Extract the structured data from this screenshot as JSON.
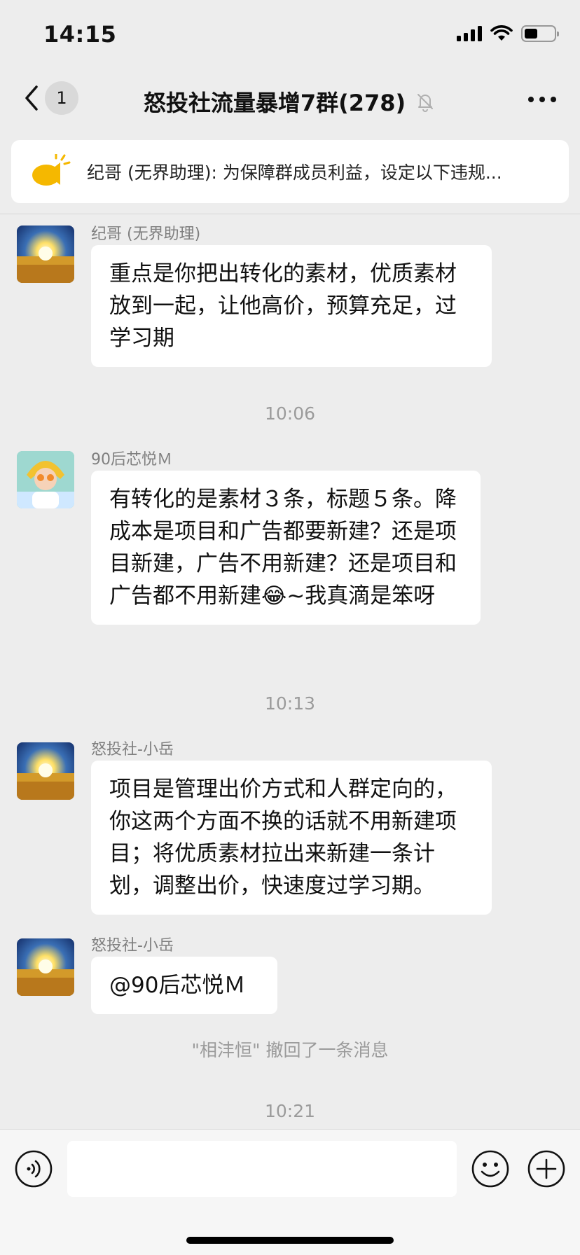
{
  "status_bar": {
    "time": "14:15",
    "battery_level": 0.46
  },
  "nav": {
    "back_count": "1",
    "title": "怒投社流量暴增7群(278)",
    "muted": true
  },
  "notice": {
    "text": "纪哥 (无界助理): 为保障群成员利益，设定以下违规..."
  },
  "messages": [
    {
      "sender": "纪哥 (无界助理)",
      "avatar": "sunset-field-avatar",
      "text": "重点是你把出转化的素材，优质素材放到一起，让他高价，预算充足，过学习期"
    },
    {
      "timestamp": "10:06"
    },
    {
      "sender": "90后芯悦Ｍ",
      "avatar": "cartoon-girl-avatar",
      "text": "有转化的是素材３条，标题５条。降成本是项目和广告都要新建？还是项目新建，广告不用新建？还是项目和广告都不用新建😂~我真滴是笨呀"
    },
    {
      "timestamp": "10:13"
    },
    {
      "sender": "怒投社-小岳",
      "avatar": "sunset-field-avatar",
      "text": "项目是管理出价方式和人群定向的，你这两个方面不换的话就不用新建项目；将优质素材拉出来新建一条计划，调整出价，快速度过学习期。"
    },
    {
      "sender": "怒投社-小岳",
      "avatar": "sunset-field-avatar",
      "text": "@90后芯悦Ｍ"
    },
    {
      "system": "\"相沣恒\" 撤回了一条消息"
    },
    {
      "timestamp": "10:21"
    }
  ],
  "input": {
    "value": "",
    "placeholder": ""
  },
  "colors": {
    "background": "#ededed",
    "bubble": "#ffffff",
    "meta_text": "#9b9b9b",
    "notice_icon": "#f5b800"
  }
}
